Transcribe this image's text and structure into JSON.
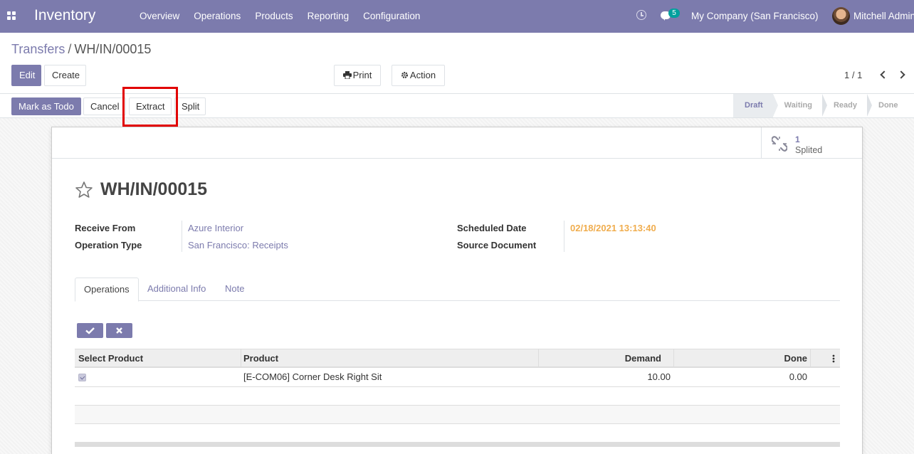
{
  "navbar": {
    "app_name": "Inventory",
    "menu": [
      "Overview",
      "Operations",
      "Products",
      "Reporting",
      "Configuration"
    ],
    "chat_count": "5",
    "company": "My Company (San Francisco)",
    "user": "Mitchell Admin"
  },
  "breadcrumb": {
    "parent": "Transfers",
    "separator": "/",
    "current": "WH/IN/00015"
  },
  "toolbar": {
    "edit": "Edit",
    "create": "Create",
    "print": "Print",
    "action": "Action",
    "pager": "1 / 1"
  },
  "statusbar": {
    "buttons": {
      "mark_todo": "Mark as Todo",
      "cancel": "Cancel",
      "extract": "Extract",
      "split": "Split"
    },
    "stages": [
      "Draft",
      "Waiting",
      "Ready",
      "Done"
    ],
    "active_stage": "Draft"
  },
  "smart_button": {
    "count": "1",
    "label": "Splited"
  },
  "record": {
    "title": "WH/IN/00015",
    "receive_from_label": "Receive From",
    "receive_from": "Azure Interior",
    "operation_type_label": "Operation Type",
    "operation_type": "San Francisco: Receipts",
    "scheduled_date_label": "Scheduled Date",
    "scheduled_date": "02/18/2021 13:13:40",
    "source_document_label": "Source Document",
    "source_document": ""
  },
  "tabs": [
    "Operations",
    "Additional Info",
    "Note"
  ],
  "table": {
    "headers": [
      "Select Product",
      "Product",
      "Demand",
      "Done"
    ],
    "rows": [
      {
        "selected": true,
        "product": "[E-COM06] Corner Desk Right Sit",
        "demand": "10.00",
        "done": "0.00"
      }
    ]
  },
  "colors": {
    "brand": "#7c7bad",
    "date": "#f0ad4e",
    "highlight": "#e10000",
    "badge": "#00a09d"
  }
}
